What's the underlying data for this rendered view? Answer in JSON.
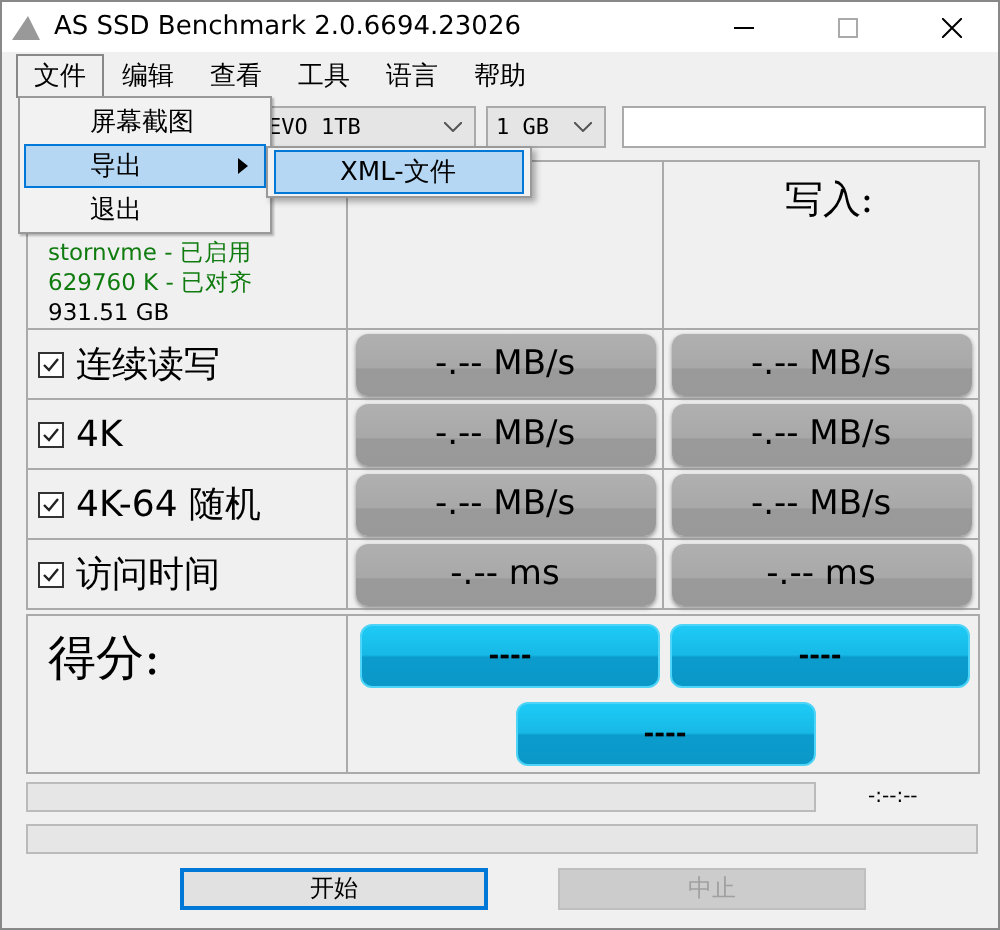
{
  "window": {
    "title": "AS SSD Benchmark 2.0.6694.23026"
  },
  "menu": [
    {
      "label": "文件",
      "selected": true
    },
    {
      "label": "编辑",
      "selected": false
    },
    {
      "label": "查看",
      "selected": false
    },
    {
      "label": "工具",
      "selected": false
    },
    {
      "label": "语言",
      "selected": false
    },
    {
      "label": "帮助",
      "selected": false
    }
  ],
  "open_menu": {
    "items": [
      {
        "label": "屏幕截图",
        "selected": false,
        "submenu": false
      },
      {
        "label": "导出",
        "selected": true,
        "submenu": true
      },
      {
        "label": "退出",
        "selected": false,
        "submenu": false
      }
    ],
    "submenu": [
      {
        "label": "XML-文件",
        "selected": true
      }
    ]
  },
  "drive_select": {
    "value": "EVO 1TB"
  },
  "size_select": {
    "value": "1 GB"
  },
  "drive_info": [
    {
      "text": "stornvme - 已启用",
      "color": "#107c10"
    },
    {
      "text": "629760 K - 已对齐",
      "color": "#107c10"
    },
    {
      "text": "931.51 GB",
      "color": "#000000"
    }
  ],
  "write_header": "写入:",
  "tests": [
    {
      "label": "连续读写",
      "checked": true,
      "read": "-.-- MB/s",
      "write": "-.-- MB/s"
    },
    {
      "label": "4K",
      "checked": true,
      "read": "-.-- MB/s",
      "write": "-.-- MB/s"
    },
    {
      "label": "4K-64 随机",
      "checked": true,
      "read": "-.-- MB/s",
      "write": "-.-- MB/s"
    },
    {
      "label": "访问时间",
      "checked": true,
      "read": "-.-- ms",
      "write": "-.-- ms"
    }
  ],
  "score": {
    "label": "得分:",
    "read": "----",
    "write": "----",
    "total": "----"
  },
  "progress": {
    "time": "-:--:--",
    "bars": [
      {
        "level": 0
      },
      {
        "level": 0
      }
    ]
  },
  "buttons": [
    {
      "label": "开始",
      "disabled": false
    },
    {
      "label": "中止",
      "disabled": true
    }
  ]
}
